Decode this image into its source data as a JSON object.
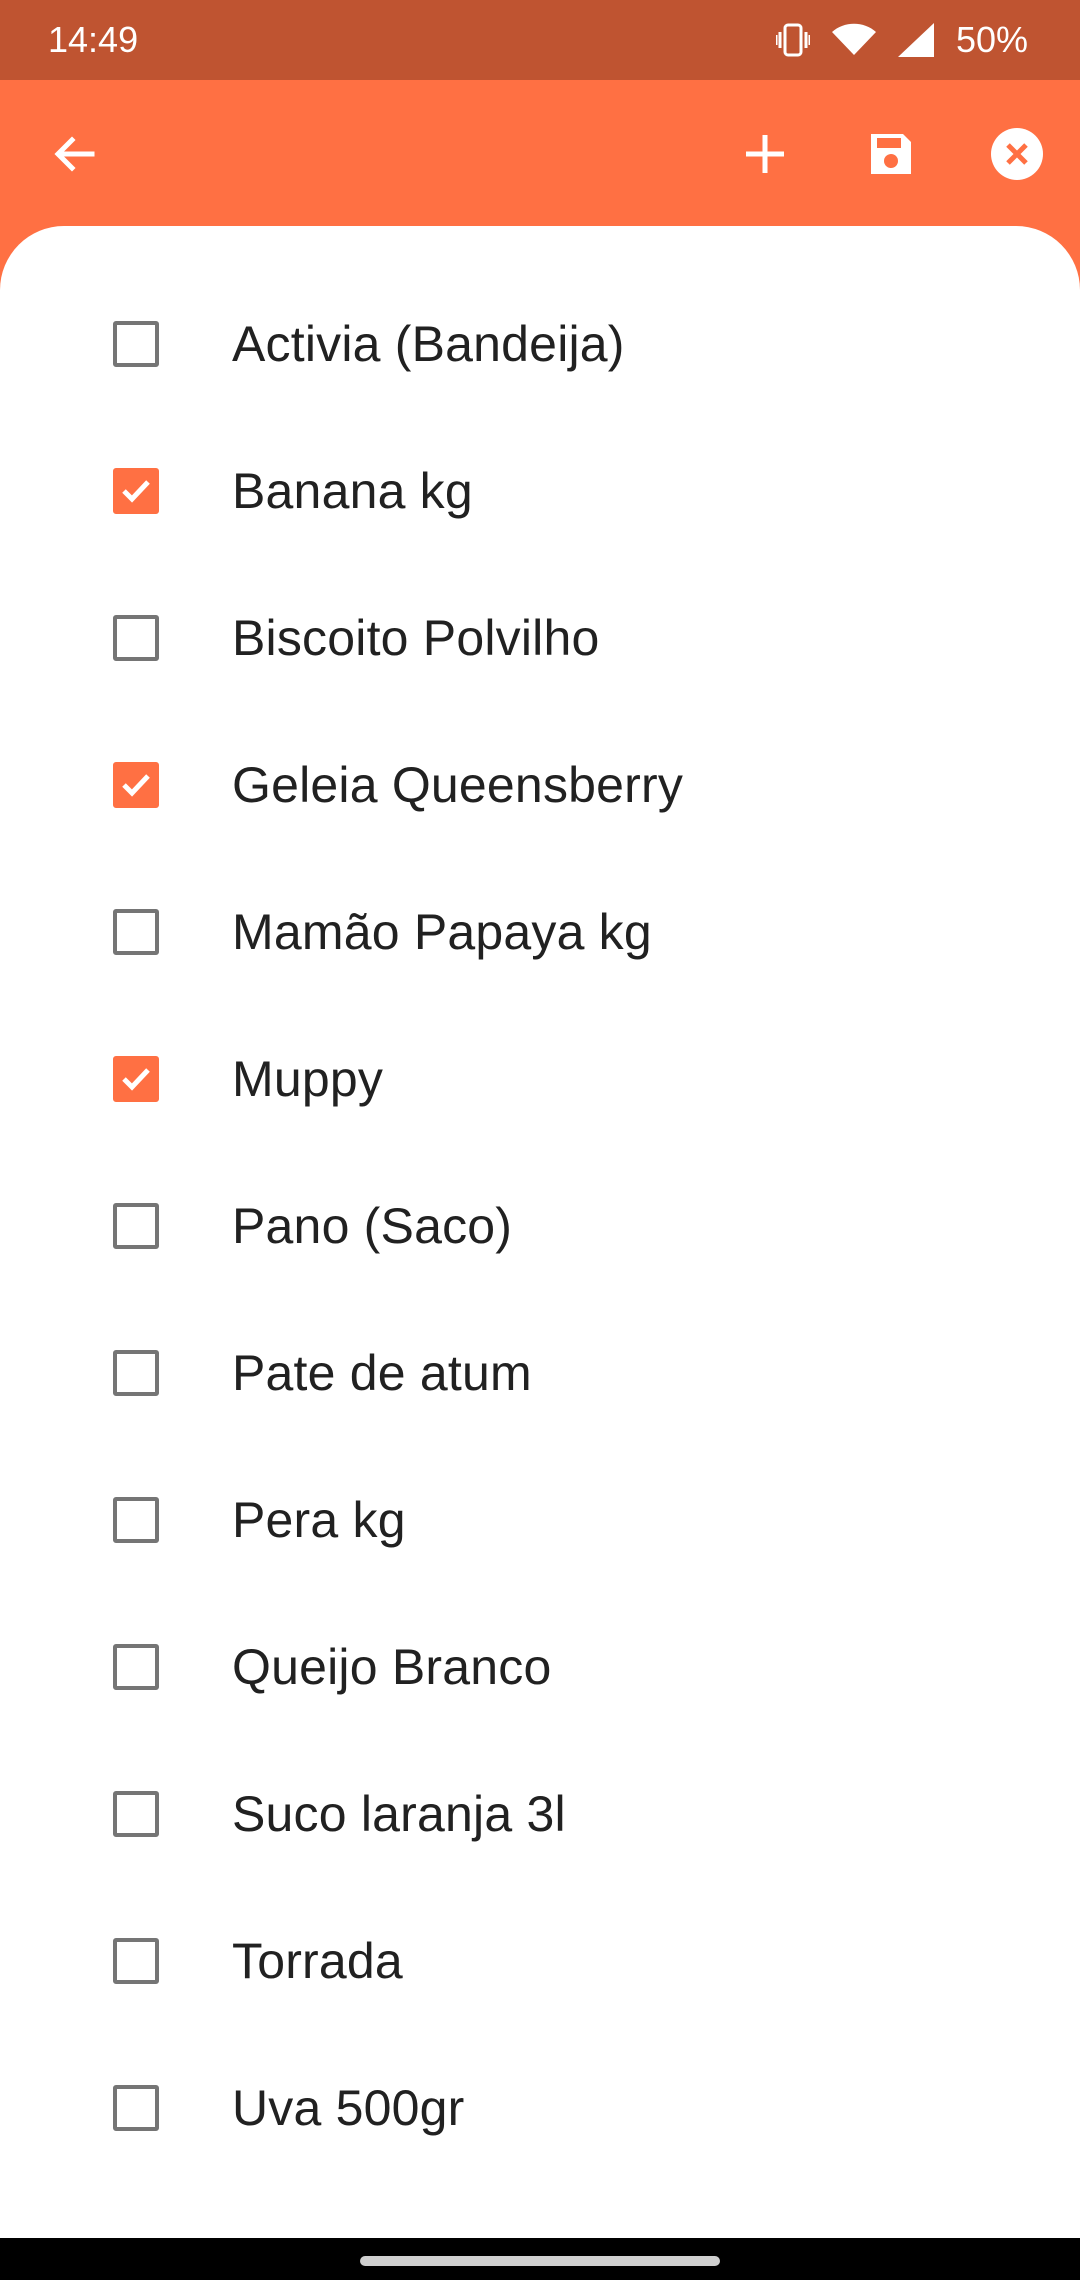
{
  "status_bar": {
    "time": "14:49",
    "battery": "50%",
    "icons": [
      "vibrate-icon",
      "wifi-icon",
      "signal-icon"
    ]
  },
  "toolbar": {
    "icons": [
      "back-arrow-icon",
      "add-icon",
      "save-icon",
      "close-circle-icon"
    ]
  },
  "colors": {
    "status_bar": "#BF5431",
    "app_bar": "#FF7043",
    "accent": "#FF7043",
    "checkbox_unchecked": "#757575",
    "text": "#212121"
  },
  "items": [
    {
      "label": "Activia (Bandeija)",
      "checked": false
    },
    {
      "label": "Banana kg",
      "checked": true
    },
    {
      "label": "Biscoito Polvilho",
      "checked": false
    },
    {
      "label": "Geleia Queensberry",
      "checked": true
    },
    {
      "label": "Mamão Papaya kg",
      "checked": false
    },
    {
      "label": "Muppy",
      "checked": true
    },
    {
      "label": "Pano (Saco)",
      "checked": false
    },
    {
      "label": "Pate de atum",
      "checked": false
    },
    {
      "label": "Pera kg",
      "checked": false
    },
    {
      "label": "Queijo Branco",
      "checked": false
    },
    {
      "label": "Suco laranja 3l",
      "checked": false
    },
    {
      "label": "Torrada",
      "checked": false
    },
    {
      "label": "Uva 500gr",
      "checked": false
    }
  ]
}
